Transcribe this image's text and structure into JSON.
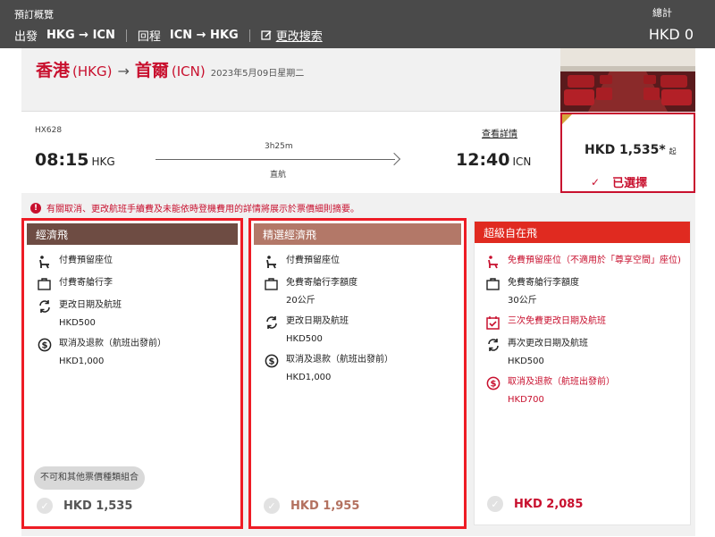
{
  "header": {
    "summary_label": "預訂概覽",
    "outbound_label": "出發",
    "outbound_route": "HKG → ICN",
    "return_label": "回程",
    "return_route": "ICN → HKG",
    "modify_label": "更改搜索",
    "total_label": "總計",
    "total_value": "HKD 0"
  },
  "route": {
    "origin_city": "香港",
    "origin_code": "(HKG)",
    "destination_city": "首爾",
    "destination_code": "(ICN)",
    "date": "2023年5月09日星期二"
  },
  "flight": {
    "number": "HX628",
    "details_link": "查看詳情",
    "departure_time": "08:15",
    "departure_airport": "HKG",
    "duration": "3h25m",
    "stops": "直航",
    "arrival_time": "12:40",
    "arrival_airport": "ICN"
  },
  "selected_fare": {
    "price": "HKD 1,535*",
    "qualifier": "起",
    "status": "已選擇"
  },
  "notice": "有關取消、更改航班手續費及未能依時登機費用的詳情將展示於票價細則摘要。",
  "fares": [
    {
      "name": "經濟飛",
      "header_color": "#6e4c43",
      "features": [
        {
          "icon": "seat-icon",
          "text": "付費預留座位"
        },
        {
          "icon": "baggage-icon",
          "text": "付費寄艙行李"
        },
        {
          "icon": "change-icon",
          "text": "更改日期及航班",
          "sub": "HKD500"
        },
        {
          "icon": "refund-icon",
          "text": "取消及退款（航班出發前）",
          "sub": "HKD1,000"
        }
      ],
      "tag": "不可和其他票價種類組合",
      "price": "HKD 1,535"
    },
    {
      "name": "精選經濟飛",
      "header_color": "#b37868",
      "features": [
        {
          "icon": "seat-icon",
          "text": "付費預留座位"
        },
        {
          "icon": "baggage-icon",
          "text": "免費寄艙行李額度",
          "sub": "20公斤"
        },
        {
          "icon": "change-icon",
          "text": "更改日期及航班",
          "sub": "HKD500"
        },
        {
          "icon": "refund-icon",
          "text": "取消及退款（航班出發前）",
          "sub": "HKD1,000"
        }
      ],
      "price": "HKD 1,955"
    },
    {
      "name": "超級自在飛",
      "header_color": "#e02a20",
      "features": [
        {
          "icon": "seat-icon",
          "text": "免費預留座位（不適用於「尊享空間」座位)"
        },
        {
          "icon": "baggage-icon",
          "text": "免費寄艙行李額度",
          "sub": "30公斤"
        },
        {
          "icon": "calendar-check-icon",
          "text": "三次免費更改日期及航班"
        },
        {
          "icon": "change-icon",
          "text": "再次更改日期及航班",
          "sub": "HKD500"
        },
        {
          "icon": "refund-icon",
          "text": "取消及退款（航班出發前）",
          "sub": "HKD700"
        }
      ],
      "price": "HKD 2,085"
    }
  ],
  "colors": {
    "brand_red": "#c8102e",
    "topbar": "#4a4a4a",
    "highlight_border": "#ee1c25"
  }
}
